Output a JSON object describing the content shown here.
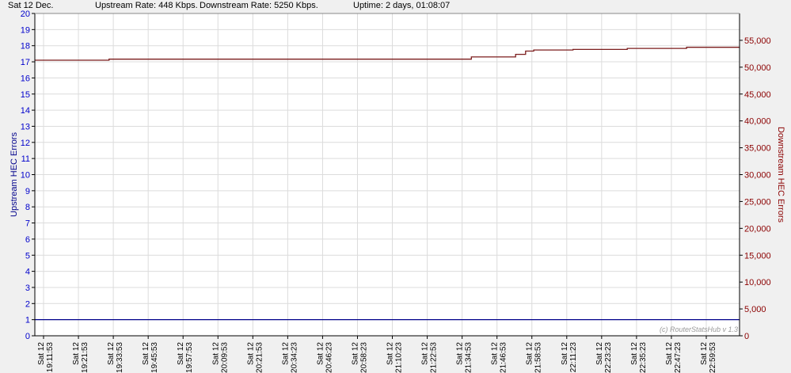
{
  "header": {
    "date": "Sat 12 Dec.",
    "upstream_rate": "Upstream Rate: 448 Kbps.",
    "downstream_rate": "Downstream Rate: 5250 Kbps.",
    "uptime": "Uptime: 2 days, 01:08:07"
  },
  "watermark": "(c) RouterStatsHub v 1.3",
  "colors": {
    "upstream": "#00008b",
    "downstream": "#7b1c1c",
    "grid": "#dcdcdc",
    "plot_bg": "#ffffff"
  },
  "chart_data": {
    "type": "line",
    "title": "",
    "xlabel": "",
    "ylabel_left": "Upstream HEC Errors",
    "ylabel_right": "Downstream HEC Errors",
    "ylim_left": [
      0,
      20
    ],
    "ylim_right": [
      0,
      60000
    ],
    "yticks_left": [
      0,
      1,
      2,
      3,
      4,
      5,
      6,
      7,
      8,
      9,
      10,
      11,
      12,
      13,
      14,
      15,
      16,
      17,
      18,
      19,
      20
    ],
    "yticks_right": [
      {
        "v": 0,
        "label": "0"
      },
      {
        "v": 5000,
        "label": "5,000"
      },
      {
        "v": 10000,
        "label": "10,000"
      },
      {
        "v": 15000,
        "label": "15,000"
      },
      {
        "v": 20000,
        "label": "20,000"
      },
      {
        "v": 25000,
        "label": "25,000"
      },
      {
        "v": 30000,
        "label": "30,000"
      },
      {
        "v": 35000,
        "label": "35,000"
      },
      {
        "v": 40000,
        "label": "40,000"
      },
      {
        "v": 45000,
        "label": "45,000"
      },
      {
        "v": 50000,
        "label": "50,000"
      },
      {
        "v": 55000,
        "label": "55,000"
      }
    ],
    "x_range_minutes": [
      0,
      113
    ],
    "x_tick_labels": [
      {
        "day": "Sat 12",
        "time": "19:11:53"
      },
      {
        "day": "Sat 12",
        "time": "19:21:53"
      },
      {
        "day": "Sat 12",
        "time": "19:33:53"
      },
      {
        "day": "Sat 12",
        "time": "19:45:53"
      },
      {
        "day": "Sat 12",
        "time": "19:57:53"
      },
      {
        "day": "Sat 12",
        "time": "20:09:53"
      },
      {
        "day": "Sat 12",
        "time": "20:21:53"
      },
      {
        "day": "Sat 12",
        "time": "20:34:23"
      },
      {
        "day": "Sat 12",
        "time": "20:46:23"
      },
      {
        "day": "Sat 12",
        "time": "20:58:23"
      },
      {
        "day": "Sat 12",
        "time": "21:10:23"
      },
      {
        "day": "Sat 12",
        "time": "21:22:53"
      },
      {
        "day": "Sat 12",
        "time": "21:34:53"
      },
      {
        "day": "Sat 12",
        "time": "21:46:53"
      },
      {
        "day": "Sat 12",
        "time": "21:58:53"
      },
      {
        "day": "Sat 12",
        "time": "22:11:23"
      },
      {
        "day": "Sat 12",
        "time": "22:23:23"
      },
      {
        "day": "Sat 12",
        "time": "22:35:23"
      },
      {
        "day": "Sat 12",
        "time": "22:47:23"
      },
      {
        "day": "Sat 12",
        "time": "22:59:53"
      }
    ],
    "series": [
      {
        "name": "Upstream HEC Errors",
        "axis": "left",
        "points": [
          [
            0,
            1
          ],
          [
            113,
            1
          ]
        ]
      },
      {
        "name": "Downstream HEC Errors",
        "axis": "right",
        "points": [
          [
            0,
            51300
          ],
          [
            11.9,
            51300
          ],
          [
            11.9,
            51500
          ],
          [
            70.0,
            51500
          ],
          [
            70.0,
            51900
          ],
          [
            77.1,
            51900
          ],
          [
            77.1,
            52400
          ],
          [
            78.7,
            52400
          ],
          [
            78.7,
            53000
          ],
          [
            80.0,
            53000
          ],
          [
            80.0,
            53200
          ],
          [
            86.3,
            53200
          ],
          [
            86.3,
            53300
          ],
          [
            95.0,
            53300
          ],
          [
            95.0,
            53500
          ],
          [
            104.5,
            53500
          ],
          [
            104.5,
            53700
          ],
          [
            113,
            53700
          ]
        ]
      }
    ]
  }
}
